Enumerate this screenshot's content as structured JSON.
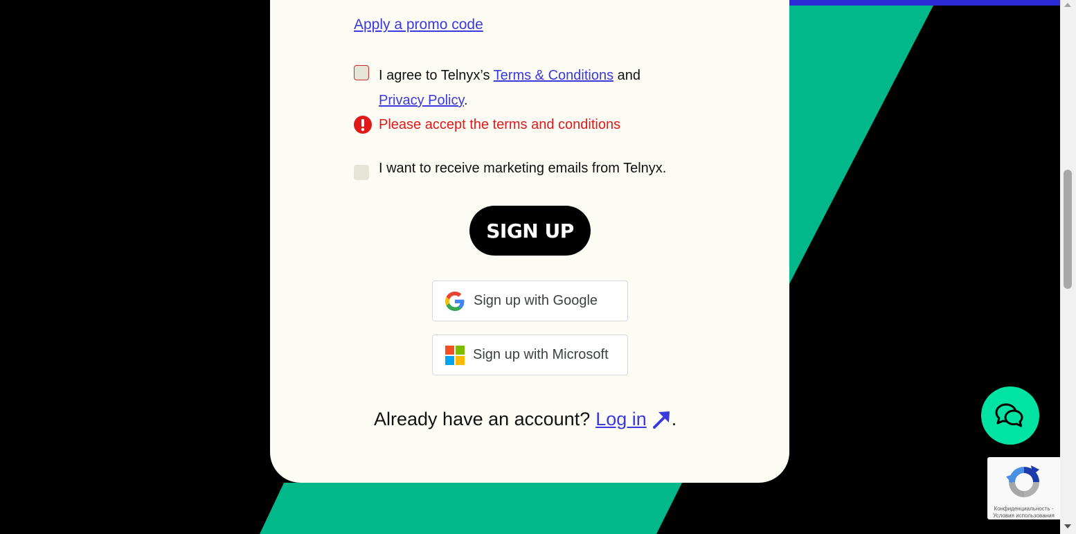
{
  "colors": {
    "page_bg": "#000000",
    "card_bg": "#fcfbf4",
    "green": "#00b88a",
    "blue_bar": "#2b2bd6",
    "link": "#3a39e0",
    "error": "#e0191b",
    "chat_bubble": "#00e3a3"
  },
  "form": {
    "promo_link": "Apply a promo code",
    "terms": {
      "prefix": "I agree to Telnyx’s",
      "terms_link": "Terms & Conditions",
      "middle": "and",
      "privacy_link": "Privacy Policy",
      "suffix": ".",
      "checked": false
    },
    "error_message": "Please accept the terms and conditions",
    "marketing": {
      "label": "I want to receive marketing emails from Telnyx.",
      "checked": false
    },
    "signup_button": "SIGN UP",
    "google_button": "Sign up with Google",
    "microsoft_button": "Sign up with Microsoft",
    "login": {
      "prompt": "Already have an account?",
      "link": "Log in",
      "suffix": "."
    }
  },
  "widgets": {
    "chat_icon": "chat-bubbles-icon",
    "recaptcha_links": "Конфиденциальность - Условия использования"
  }
}
